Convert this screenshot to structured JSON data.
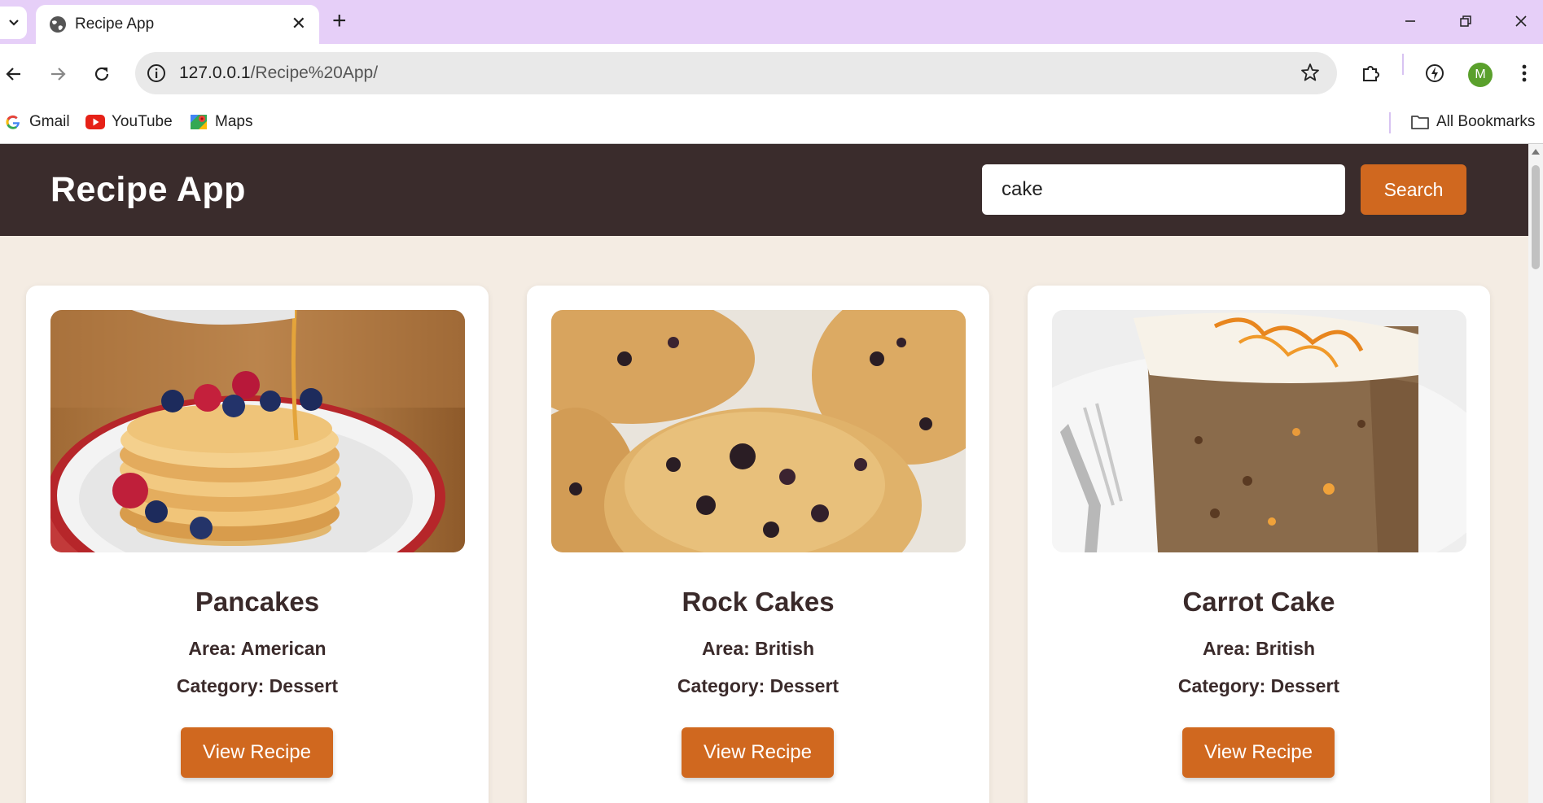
{
  "browser": {
    "tab_title": "Recipe App",
    "url_host": "127.0.0.1",
    "url_path": "/Recipe%20App/",
    "profile_initial": "M",
    "accent_color": "#e6cff8"
  },
  "bookmarks": {
    "items": [
      {
        "label": "Gmail",
        "icon": "google-icon"
      },
      {
        "label": "YouTube",
        "icon": "youtube-icon"
      },
      {
        "label": "Maps",
        "icon": "maps-icon"
      }
    ],
    "all_label": "All Bookmarks"
  },
  "app": {
    "title": "Recipe App",
    "search": {
      "value": "cake",
      "button_label": "Search"
    },
    "colors": {
      "header": "#3a2c2c",
      "accent": "#d0681f",
      "background": "#f4ece3"
    },
    "recipes": [
      {
        "name": "Pancakes",
        "area": "Area: American",
        "category": "Category: Dessert",
        "button_label": "View Recipe"
      },
      {
        "name": "Rock Cakes",
        "area": "Area: British",
        "category": "Category: Dessert",
        "button_label": "View Recipe"
      },
      {
        "name": "Carrot Cake",
        "area": "Area: British",
        "category": "Category: Dessert",
        "button_label": "View Recipe"
      }
    ]
  }
}
